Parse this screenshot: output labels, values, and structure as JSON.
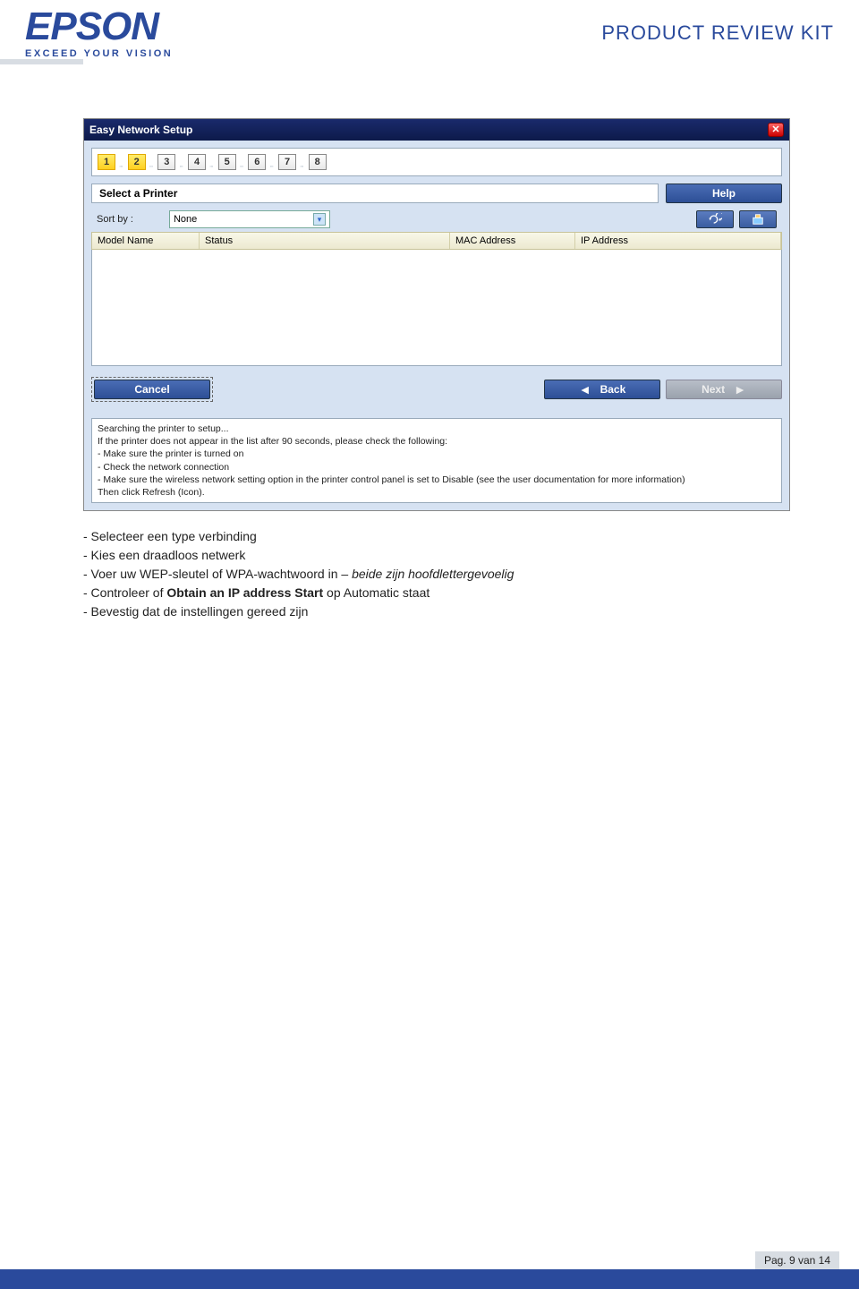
{
  "header": {
    "logo_text": "EPSON",
    "reg": "®",
    "tagline": "EXCEED YOUR VISION",
    "kit_title": "PRODUCT REVIEW KIT"
  },
  "dialog": {
    "title": "Easy Network Setup",
    "close": "✕",
    "steps": [
      "1",
      "2",
      "3",
      "4",
      "5",
      "6",
      "7",
      "8"
    ],
    "active_steps": [
      0,
      1
    ],
    "section_label": "Select a Printer",
    "help_label": "Help",
    "sort_label": "Sort by :",
    "sort_value": "None",
    "columns": [
      "Model Name",
      "Status",
      "MAC Address",
      "IP Address"
    ],
    "cancel_label": "Cancel",
    "back_label": "Back",
    "next_label": "Next",
    "info_lines": [
      "Searching the printer to setup...",
      "",
      "If the printer does not appear in the list after 90 seconds, please check the following:",
      "- Make sure the printer is turned on",
      "- Check the network connection",
      "- Make sure the wireless network setting option in the printer control panel is set to Disable (see the user documentation for more information)",
      "Then click Refresh (Icon)."
    ]
  },
  "instructions": {
    "l1": "- Selecteer een type verbinding",
    "l2": "- Kies een draadloos netwerk",
    "l3a": "- Voer uw WEP-sleutel of WPA-wachtwoord in – ",
    "l3b": "beide zijn hoofdlettergevoelig",
    "l4a": "- Controleer of ",
    "l4b": "Obtain an IP address Start",
    "l4c": " op Automatic staat",
    "l5": "- Bevestig dat de instellingen gereed zijn"
  },
  "footer": {
    "page": "Pag. 9 van 14"
  }
}
